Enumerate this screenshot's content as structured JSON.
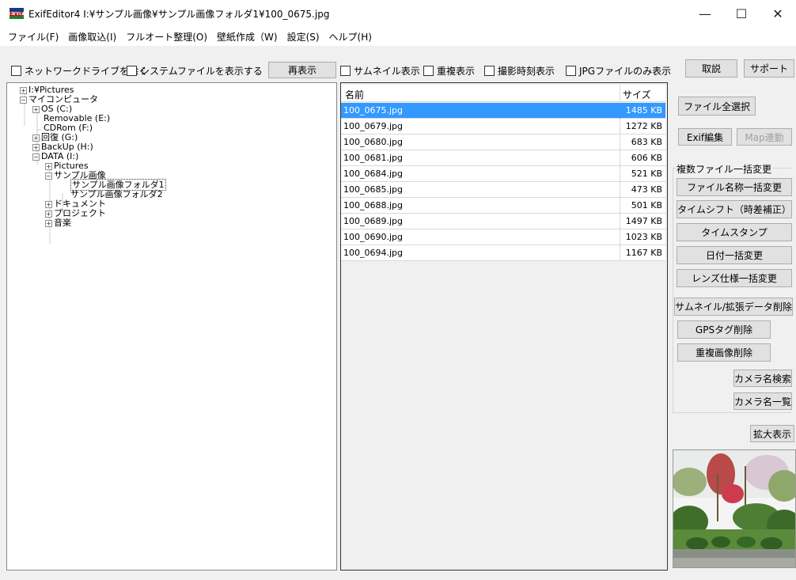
{
  "window": {
    "title": "ExifEditor4  I:¥サンプル画像¥サンプル画像フォルダ1¥100_0675.jpg",
    "app_icon_text": "Exif",
    "minimize": "—",
    "maximize": "☐",
    "close": "✕"
  },
  "menu": [
    "ファイル(F)",
    "画像取込(I)",
    "フルオート整理(O)",
    "壁紙作成（W)",
    "設定(S)",
    "ヘルプ(H)"
  ],
  "toolbar_left": {
    "exclude_network": "ネットワークドライブを除く",
    "show_system_files": "システムファイルを表示する",
    "refresh_button": "再表示"
  },
  "toolbar_mid": {
    "thumbnail": "サムネイル表示",
    "duplicate": "重複表示",
    "shot_time": "撮影時刻表示",
    "jpg_only": "JPGファイルのみ表示"
  },
  "toolbar_right": {
    "manual": "取説",
    "support": "サポート"
  },
  "tree": [
    {
      "label": "I:¥Pictures",
      "expander": "+"
    },
    {
      "label": "マイコンピュータ",
      "expander": "−"
    },
    {
      "label": "OS (C:)",
      "expander": "+"
    },
    {
      "label": "Removable (E:)",
      "expander": ""
    },
    {
      "label": "CDRom (F:)",
      "expander": ""
    },
    {
      "label": "回復 (G:)",
      "expander": "+"
    },
    {
      "label": "BackUp (H:)",
      "expander": "+"
    },
    {
      "label": "DATA (I:)",
      "expander": "−"
    },
    {
      "label": "Pictures",
      "expander": "+"
    },
    {
      "label": "サンプル画像",
      "expander": "−"
    },
    {
      "label": "サンプル画像フォルダ1",
      "expander": ""
    },
    {
      "label": "サンプル画像フォルダ2",
      "expander": ""
    },
    {
      "label": "ドキュメント",
      "expander": "+"
    },
    {
      "label": "プロジェクト",
      "expander": "+"
    },
    {
      "label": "音楽",
      "expander": "+"
    }
  ],
  "file_list": {
    "header_name": "名前",
    "header_size": "サイズ",
    "rows": [
      {
        "name": "100_0675.jpg",
        "size": "1485 KB",
        "selected": true
      },
      {
        "name": "100_0679.jpg",
        "size": "1272 KB",
        "selected": false
      },
      {
        "name": "100_0680.jpg",
        "size": "683 KB",
        "selected": false
      },
      {
        "name": "100_0681.jpg",
        "size": "606 KB",
        "selected": false
      },
      {
        "name": "100_0684.jpg",
        "size": "521 KB",
        "selected": false
      },
      {
        "name": "100_0685.jpg",
        "size": "473 KB",
        "selected": false
      },
      {
        "name": "100_0688.jpg",
        "size": "501 KB",
        "selected": false
      },
      {
        "name": "100_0689.jpg",
        "size": "1497 KB",
        "selected": false
      },
      {
        "name": "100_0690.jpg",
        "size": "1023 KB",
        "selected": false
      },
      {
        "name": "100_0694.jpg",
        "size": "1167 KB",
        "selected": false
      }
    ]
  },
  "right_panel": {
    "select_all": "ファイル全選択",
    "exif_edit": "Exif編集",
    "map_link": "Map連動",
    "group_label": "複数ファイル一括変更",
    "rename": "ファイル名称一括変更",
    "timeshift": "タイムシフト（時差補正）",
    "timestamp": "タイムスタンプ",
    "date_change": "日付一括変更",
    "lens_change": "レンズ仕様一括変更",
    "thumb_delete": "サムネイル/拡張データ削除",
    "gps_delete": "GPSタグ削除",
    "dup_delete": "重複画像削除",
    "camera_search": "カメラ名検索",
    "camera_list": "カメラ名一覧",
    "zoom": "拡大表示"
  },
  "colors": {
    "selection": "#3399ff",
    "window_bg": "#f0f0f0"
  }
}
